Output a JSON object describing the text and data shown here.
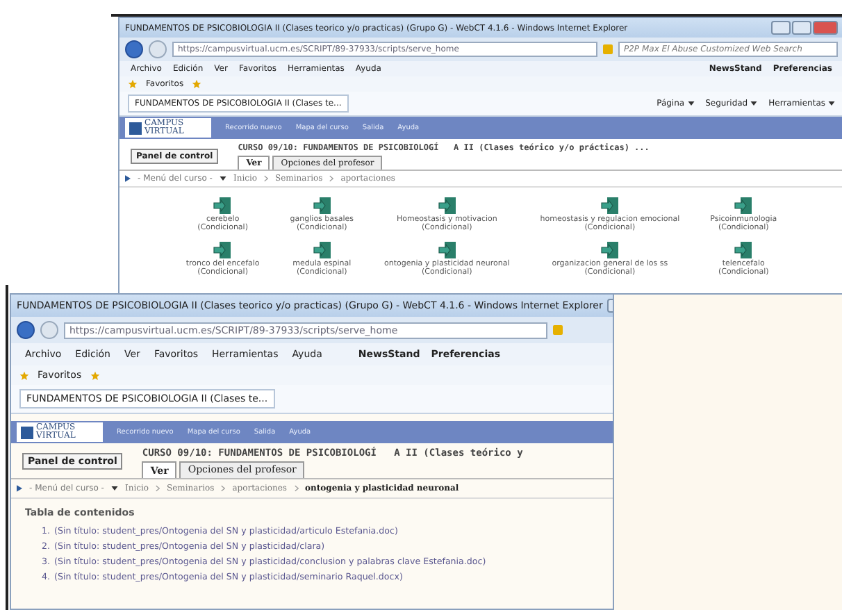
{
  "windows": [
    {
      "title": "FUNDAMENTOS DE PSICOBIOLOGIA II (Clases teorico y/o practicas) (Grupo G) - WebCT 4.1.6 - Windows Internet Explorer",
      "address": "https://campusvirtual.ucm.es/SCRIPT/89-37933/scripts/serve_home",
      "search": {
        "placeholder": "P2P Max El Abuse Customized Web Search"
      },
      "menu": [
        "Archivo",
        "Edición",
        "Ver",
        "Favoritos",
        "Herramientas",
        "Ayuda"
      ],
      "toolbar_links": [
        "NewsStand",
        "Preferencias"
      ],
      "favorites": "Favoritos",
      "browser_tab": "FUNDAMENTOS DE PSICOBIOLOGIA II (Clases te...",
      "commands": [
        "Página",
        "Seguridad",
        "Herramientas"
      ],
      "logo": [
        "CAMPUS",
        "VIRTUAL"
      ],
      "banner_links": [
        "Recorrido nuevo",
        "Mapa del curso",
        "Salida",
        "Ayuda"
      ],
      "panel_button": "Panel de control",
      "course_title": "CURSO 09/10: FUNDAMENTOS DE PSICOBIOLOGÍ   A II (Clases teórico y/o prácticas) ...",
      "tabs": [
        {
          "label": "Ver",
          "selected": true
        },
        {
          "label": "Opciones del profesor",
          "selected": false
        }
      ],
      "course_menu": "- Menú del curso -",
      "breadcrumb": [
        "Inicio",
        "Seminarios",
        "aportaciones"
      ],
      "content": {
        "kind": "icons",
        "items": [
          {
            "label": "cerebelo",
            "note": "(Condicional)"
          },
          {
            "label": "ganglios basales",
            "note": "(Condicional)"
          },
          {
            "label": "Homeostasis y motivacion",
            "note": "(Condicional)"
          },
          {
            "label": "homeostasis y regulacion emocional",
            "note": "(Condicional)"
          },
          {
            "label": "Psicoinmunologia",
            "note": "(Condicional)"
          },
          {
            "label": "tronco del encefalo",
            "note": "(Condicional)"
          },
          {
            "label": "medula espinal",
            "note": "(Condicional)"
          },
          {
            "label": "ontogenia y plasticidad neuronal",
            "note": "(Condicional)"
          },
          {
            "label": "organizacion general de los ss",
            "note": "(Condicional)"
          },
          {
            "label": "telencefalo",
            "note": "(Condicional)"
          }
        ]
      }
    },
    {
      "title": "FUNDAMENTOS DE PSICOBIOLOGIA II (Clases teorico y/o practicas) (Grupo G) - WebCT 4.1.6 - Windows Internet Explorer",
      "address": "https://campusvirtual.ucm.es/SCRIPT/89-37933/scripts/serve_home",
      "menu": [
        "Archivo",
        "Edición",
        "Ver",
        "Favoritos",
        "Herramientas",
        "Ayuda"
      ],
      "toolbar_links": [
        "NewsStand",
        "Preferencias"
      ],
      "favorites": "Favoritos",
      "browser_tab": "FUNDAMENTOS DE PSICOBIOLOGIA II (Clases te...",
      "logo": [
        "CAMPUS",
        "VIRTUAL"
      ],
      "banner_links": [
        "Recorrido nuevo",
        "Mapa del curso",
        "Salida",
        "Ayuda"
      ],
      "panel_button": "Panel de control",
      "course_title": "CURSO 09/10: FUNDAMENTOS DE PSICOBIOLOGÍ   A II (Clases teórico y",
      "tabs": [
        {
          "label": "Ver",
          "selected": true
        },
        {
          "label": "Opciones del profesor",
          "selected": false
        }
      ],
      "course_menu": "- Menú del curso -",
      "breadcrumb": [
        "Inicio",
        "Seminarios",
        "aportaciones",
        "ontogenia y plasticidad neuronal"
      ],
      "content": {
        "kind": "toc",
        "heading": "Tabla de contenidos",
        "items": [
          {
            "number": "1.",
            "label": "(Sin título: student_pres/Ontogenia del SN y plasticidad/articulo Estefania.doc)"
          },
          {
            "number": "2.",
            "label": "(Sin título: student_pres/Ontogenia del SN y plasticidad/clara)"
          },
          {
            "number": "3.",
            "label": "(Sin título: student_pres/Ontogenia del SN y plasticidad/conclusion y palabras clave Estefania.doc)"
          },
          {
            "number": "4.",
            "label": "(Sin título: student_pres/Ontogenia del SN y plasticidad/seminario Raquel.docx)"
          }
        ]
      }
    }
  ]
}
